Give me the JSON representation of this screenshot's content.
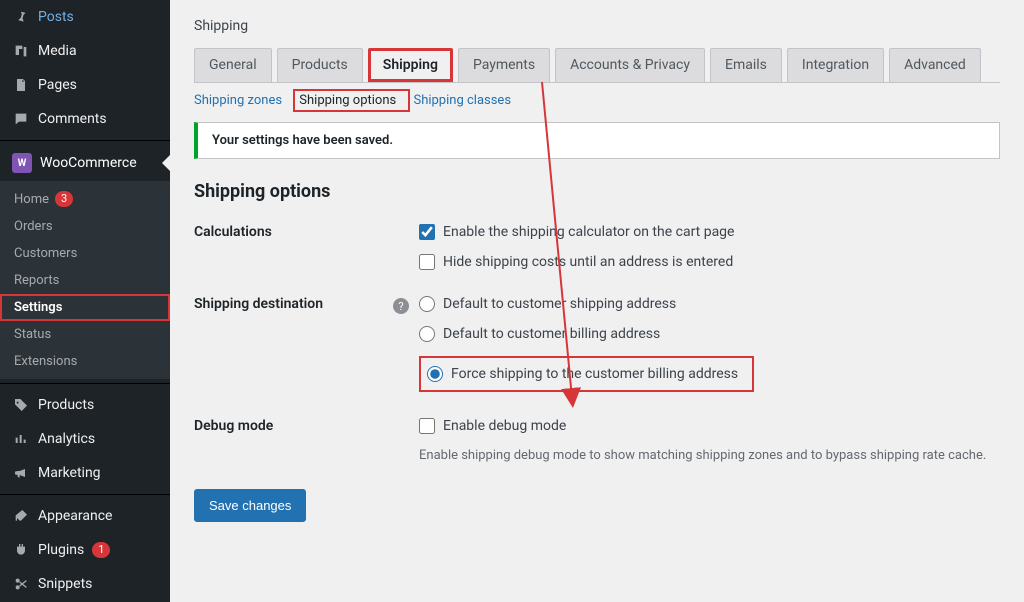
{
  "page_title": "Shipping",
  "sidebar": {
    "top": [
      {
        "label": "Posts",
        "icon": "posts"
      },
      {
        "label": "Media",
        "icon": "media"
      },
      {
        "label": "Pages",
        "icon": "pages"
      },
      {
        "label": "Comments",
        "icon": "comments"
      }
    ],
    "wc_label": "WooCommerce",
    "wc_sub": [
      {
        "label": "Home",
        "badge": "3"
      },
      {
        "label": "Orders"
      },
      {
        "label": "Customers"
      },
      {
        "label": "Reports"
      },
      {
        "label": "Settings",
        "active": true
      },
      {
        "label": "Status"
      },
      {
        "label": "Extensions"
      }
    ],
    "mid": [
      {
        "label": "Products",
        "icon": "products"
      },
      {
        "label": "Analytics",
        "icon": "analytics"
      },
      {
        "label": "Marketing",
        "icon": "marketing"
      }
    ],
    "bottom": [
      {
        "label": "Appearance",
        "icon": "appearance"
      },
      {
        "label": "Plugins",
        "icon": "plugins",
        "badge": "1"
      },
      {
        "label": "Snippets",
        "icon": "snippets"
      }
    ]
  },
  "tabs": [
    "General",
    "Products",
    "Shipping",
    "Payments",
    "Accounts & Privacy",
    "Emails",
    "Integration",
    "Advanced"
  ],
  "active_tab": "Shipping",
  "subtabs": [
    "Shipping zones",
    "Shipping options",
    "Shipping classes"
  ],
  "active_subtab": "Shipping options",
  "notice_text": "Your settings have been saved.",
  "section_heading": "Shipping options",
  "rows": {
    "calculations": {
      "label": "Calculations",
      "opt1": "Enable the shipping calculator on the cart page",
      "opt2": "Hide shipping costs until an address is entered"
    },
    "destination": {
      "label": "Shipping destination",
      "r1": "Default to customer shipping address",
      "r2": "Default to customer billing address",
      "r3": "Force shipping to the customer billing address"
    },
    "debug": {
      "label": "Debug mode",
      "opt": "Enable debug mode",
      "desc": "Enable shipping debug mode to show matching shipping zones and to bypass shipping rate cache."
    }
  },
  "save_label": "Save changes"
}
